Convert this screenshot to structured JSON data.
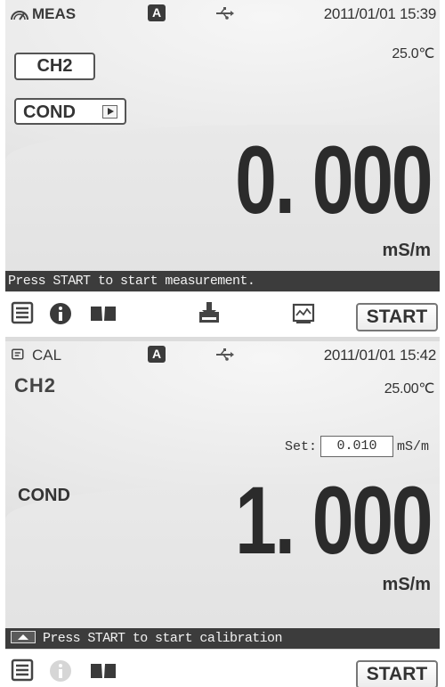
{
  "meas": {
    "mode_icon": "gauge-icon",
    "mode_label": "MEAS",
    "auto_badge": "A",
    "usb_icon": "usb-icon",
    "datetime": "2011/01/01 15:39",
    "channel": "CH2",
    "temperature": "25.0℃",
    "parameter": "COND",
    "value": "0. 000",
    "unit": "mS/m",
    "message": "Press START to start measurement.",
    "toolbar": {
      "icons": [
        "menu-list-icon",
        "info-icon",
        "book-icon",
        "download-icon",
        "graph-icon"
      ],
      "start_label": "START"
    }
  },
  "cal": {
    "mode_icon": "calibration-icon",
    "mode_label": "CAL",
    "auto_badge": "A",
    "usb_icon": "usb-icon",
    "datetime": "2011/01/01 15:42",
    "channel": "CH2",
    "temperature": "25.00℃",
    "set_label": "Set:",
    "set_value": "0.010",
    "set_unit": "mS/m",
    "parameter": "COND",
    "value": "1. 000",
    "unit": "mS/m",
    "message": "Press START to start calibration",
    "toolbar": {
      "icons": [
        "menu-list-icon",
        "info-icon",
        "book-icon"
      ],
      "start_label": "START"
    }
  },
  "colors": {
    "status_bar": "#3c3c3c",
    "background": "#e6e6e6",
    "text": "#2b2b2b"
  }
}
